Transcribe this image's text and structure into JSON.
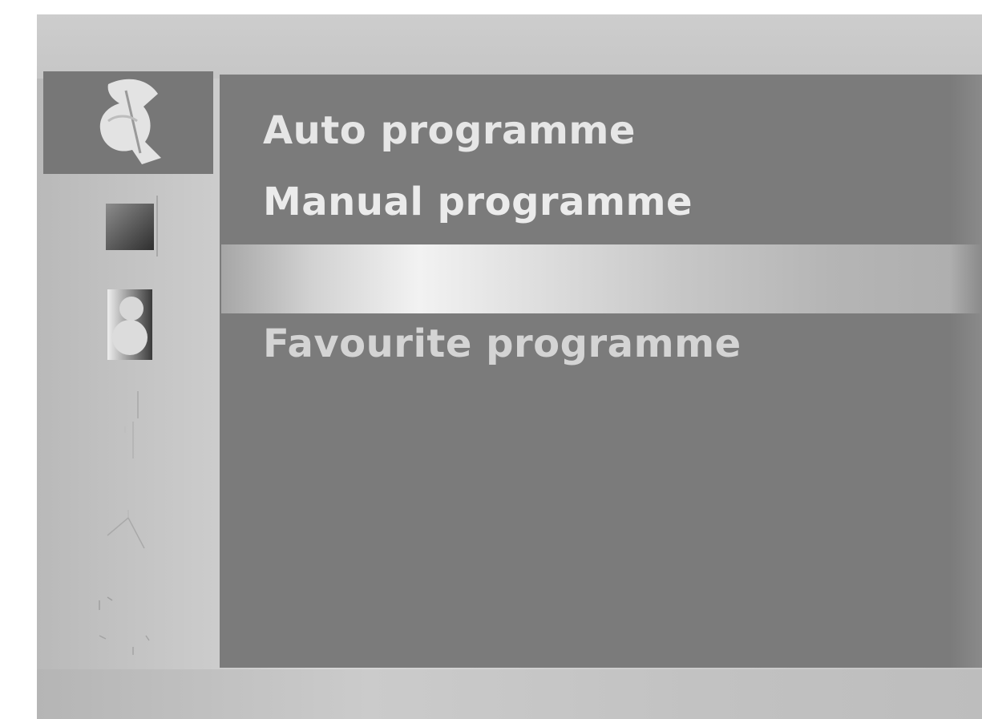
{
  "menu": {
    "items": [
      {
        "label": "Auto programme",
        "selected": false
      },
      {
        "label": "Manual programme",
        "selected": false
      },
      {
        "label": "",
        "selected": true
      },
      {
        "label": "Favourite programme",
        "selected": false
      }
    ]
  },
  "sidebar": {
    "icons": [
      {
        "icon": "satellite-dish-icon",
        "active": true
      },
      {
        "icon": "picture-icon",
        "active": false
      },
      {
        "icon": "speaker-icon",
        "active": false
      },
      {
        "icon": "time-icon",
        "active": false
      },
      {
        "icon": "option-icon",
        "active": false
      },
      {
        "icon": "lock-icon",
        "active": false
      }
    ]
  },
  "colors": {
    "panel": "#7b7b7b",
    "active_icon_bg": "#777777",
    "frame": "#cfcfcf",
    "text": "#e6e6e6"
  }
}
